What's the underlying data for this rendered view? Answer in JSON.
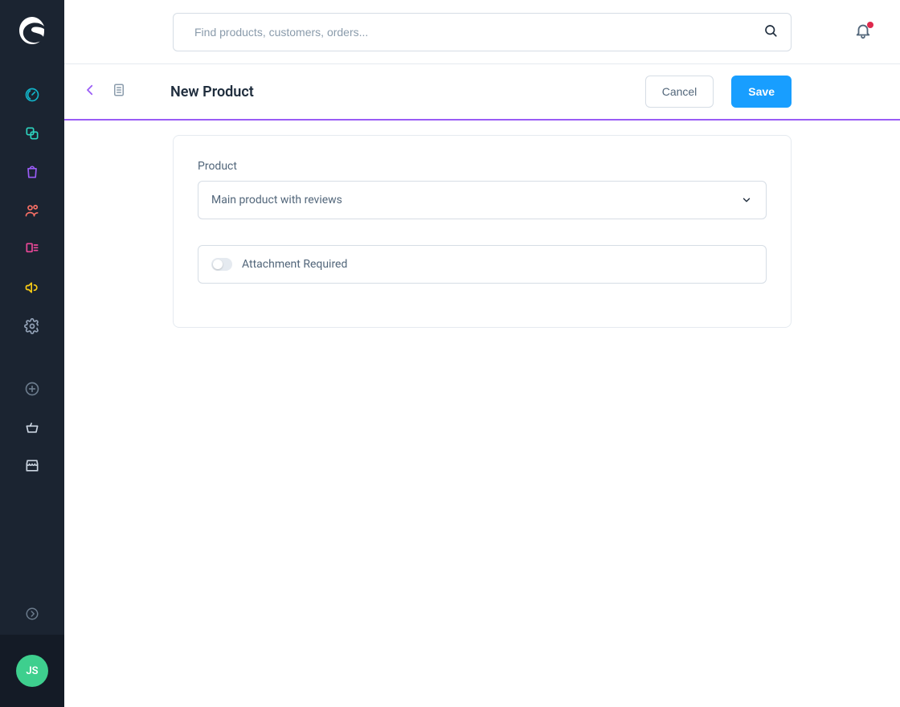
{
  "sidebar": {
    "user_initials": "JS",
    "items": [
      {
        "name": "dashboard",
        "color": "#12b4c9"
      },
      {
        "name": "catalogues",
        "color": "#2dd4bf"
      },
      {
        "name": "orders",
        "color": "#9a5cf6"
      },
      {
        "name": "customers",
        "color": "#f97066"
      },
      {
        "name": "content",
        "color": "#ec4899"
      },
      {
        "name": "marketing",
        "color": "#facc15"
      },
      {
        "name": "settings",
        "color": "#94a3b8"
      }
    ],
    "secondary": [
      {
        "name": "plus",
        "color": "#94a3b8"
      },
      {
        "name": "basket",
        "color": "#94a3b8"
      },
      {
        "name": "storefront",
        "color": "#94a3b8"
      }
    ]
  },
  "search": {
    "placeholder": "Find products, customers, orders..."
  },
  "header": {
    "title": "New Product",
    "cancel_label": "Cancel",
    "save_label": "Save"
  },
  "form": {
    "product_label": "Product",
    "product_value": "Main product with reviews",
    "attachment_label": "Attachment Required",
    "attachment_on": false
  },
  "notifications": {
    "has_unread": true
  }
}
